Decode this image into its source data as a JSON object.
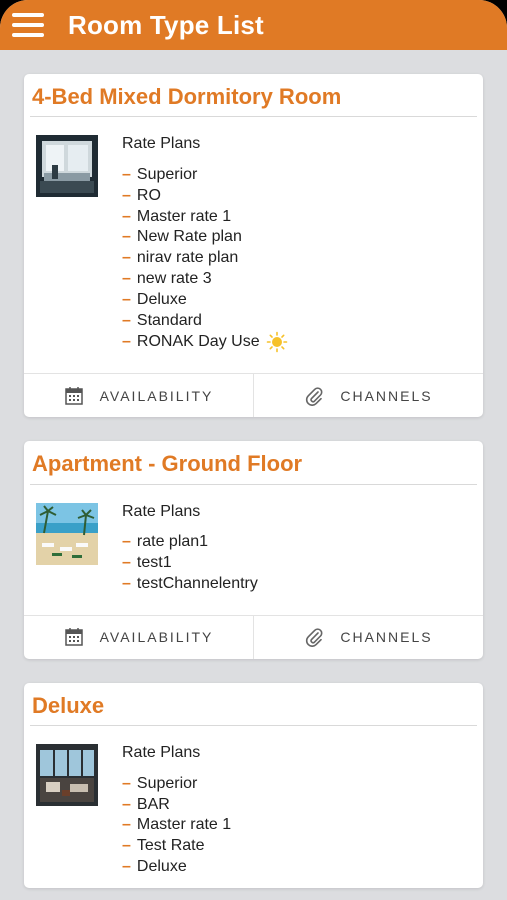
{
  "header": {
    "title": "Room Type List"
  },
  "colors": {
    "accent": "#e07a25",
    "background": "#dcdde0"
  },
  "cards": [
    {
      "title": "4-Bed Mixed Dormitory Room",
      "rate_plans_label": "Rate Plans",
      "rate_plans": [
        "Superior",
        "RO",
        "Master rate 1",
        "New Rate plan",
        "nirav rate plan",
        "new rate 3",
        "Deluxe",
        "Standard",
        "RONAK Day Use"
      ],
      "availability_label": "AVAILABILITY",
      "channels_label": "CHANNELS",
      "thumbnail": "dormitory-room-photo"
    },
    {
      "title": "Apartment - Ground Floor",
      "rate_plans_label": "Rate Plans",
      "rate_plans": [
        "rate plan1",
        "test1",
        "testChannelentry"
      ],
      "availability_label": "AVAILABILITY",
      "channels_label": "CHANNELS",
      "thumbnail": "beach-resort-photo"
    },
    {
      "title": "Deluxe",
      "rate_plans_label": "Rate Plans",
      "rate_plans": [
        "Superior",
        "BAR",
        "Master rate 1",
        "Test Rate",
        "Deluxe"
      ],
      "thumbnail": "lounge-room-photo"
    }
  ]
}
